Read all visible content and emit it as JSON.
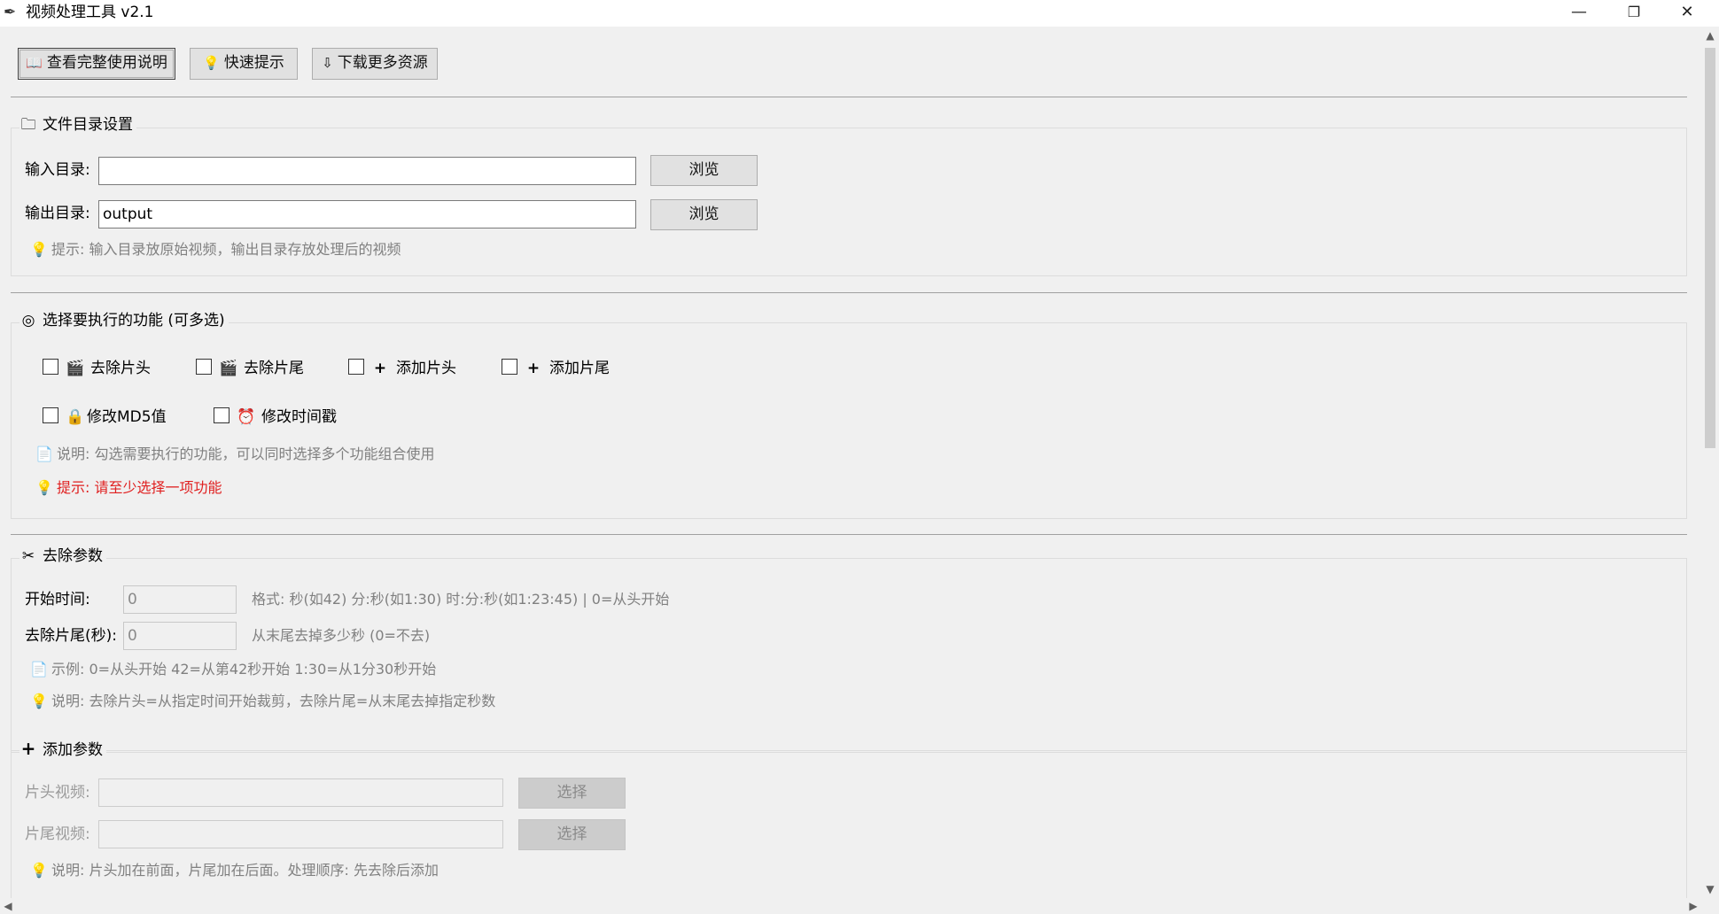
{
  "window": {
    "title": "视频处理工具 v2.1",
    "icon": "feather-icon",
    "minimize": "—",
    "restore": "❐",
    "close": "✕"
  },
  "toolbar": {
    "manual_label": "查看完整使用说明",
    "manual_icon": "book-icon",
    "tips_label": "快速提示",
    "tips_icon": "lightbulb-icon",
    "download_label": "下载更多资源",
    "download_icon": "download-tray-icon"
  },
  "directories": {
    "title": "文件目录设置",
    "icon": "folder-icon",
    "input_label": "输入目录:",
    "input_value": "",
    "output_label": "输出目录:",
    "output_value": "output",
    "browse_label": "浏览",
    "hint": "提示: 输入目录放原始视频，输出目录存放处理后的视频"
  },
  "functions": {
    "title": "选择要执行的功能 (可多选)",
    "icon": "target-icon",
    "options": [
      {
        "label": "去除片头",
        "icon": "clapperboard-icon",
        "checked": false
      },
      {
        "label": "去除片尾",
        "icon": "clapperboard-icon",
        "checked": false
      },
      {
        "label": "添加片头",
        "icon": "plus-icon",
        "checked": false
      },
      {
        "label": "添加片尾",
        "icon": "plus-icon",
        "checked": false
      },
      {
        "label": "修改MD5值",
        "icon": "lock-icon",
        "checked": false
      },
      {
        "label": "修改时间戳",
        "icon": "alarm-clock-icon",
        "checked": false
      }
    ],
    "note": "说明: 勾选需要执行的功能，可以同时选择多个功能组合使用",
    "warning": "提示: 请至少选择一项功能",
    "warning_color": "#e02020"
  },
  "remove_params": {
    "title": "去除参数",
    "icon": "scissors-icon",
    "start_label": "开始时间:",
    "start_value": "0",
    "start_format": "格式: 秒(如42) 分:秒(如1:30) 时:分:秒(如1:23:45) | 0=从头开始",
    "tail_label": "去除片尾(秒):",
    "tail_value": "0",
    "tail_hint": "从末尾去掉多少秒 (0=不去)",
    "example": "示例: 0=从头开始 42=从第42秒开始 1:30=从1分30秒开始",
    "note": "说明: 去除片头=从指定时间开始裁剪，去除片尾=从末尾去掉指定秒数"
  },
  "add_params": {
    "title": "添加参数",
    "icon": "plus-icon",
    "intro_label": "片头视频:",
    "intro_value": "",
    "outro_label": "片尾视频:",
    "outro_value": "",
    "select_label": "选择",
    "note": "说明: 片头加在前面，片尾加在后面。处理顺序: 先去除后添加"
  }
}
